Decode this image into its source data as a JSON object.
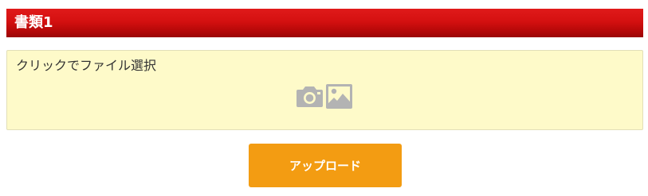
{
  "section": {
    "title": "書類1"
  },
  "upload_zone": {
    "label": "クリックでファイル選択",
    "icons": [
      "camera-icon",
      "image-icon"
    ],
    "background": "#fefac9"
  },
  "upload_button": {
    "label": "アップロード",
    "color": "#f39c12"
  },
  "colors": {
    "header": "#c00d0d",
    "icon": "#b3b3b3"
  }
}
